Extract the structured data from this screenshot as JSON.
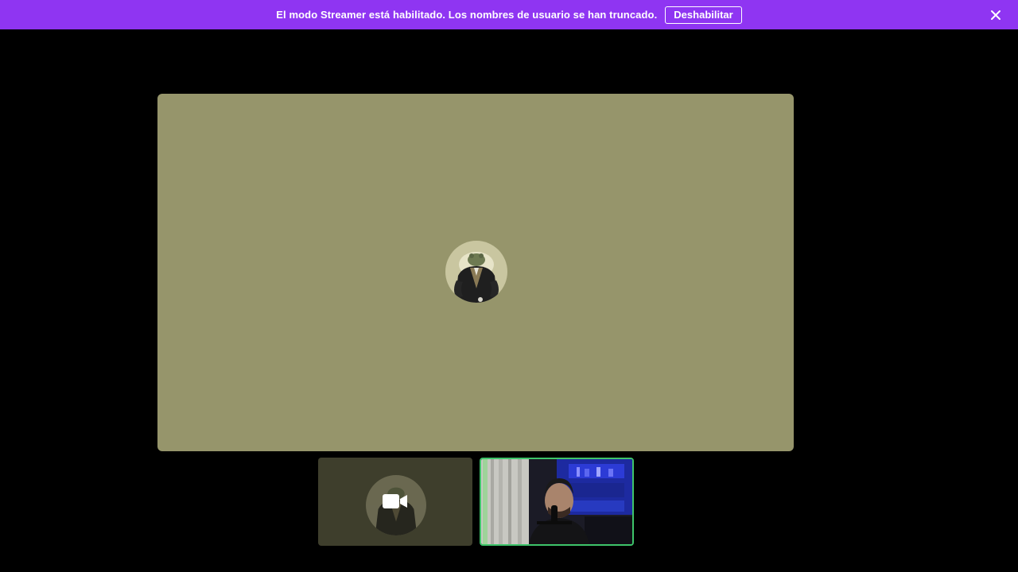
{
  "banner": {
    "message": "El modo Streamer está habilitado. Los nombres de usuario se han truncado.",
    "button_label": "Deshabilitar",
    "close_icon": "close-icon",
    "background": "#8f35f2"
  },
  "stage": {
    "main_tile_color": "#96956b",
    "main_avatar_icon": "frog-avatar"
  },
  "thumbnails": [
    {
      "type": "avatar-camera-off",
      "icon": "video-camera-icon",
      "background": "#3e3e2c"
    },
    {
      "type": "webcam-video",
      "active_speaker": true,
      "border_color": "#3ec46a"
    }
  ]
}
